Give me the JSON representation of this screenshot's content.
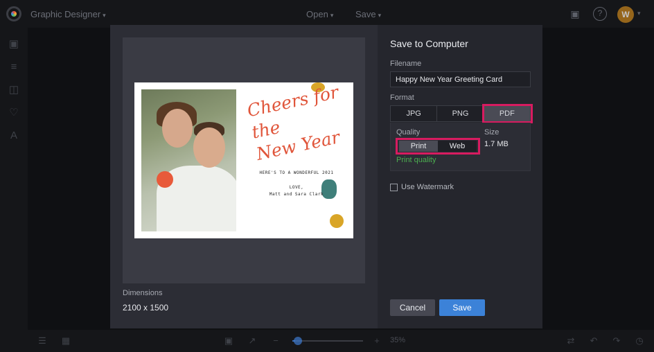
{
  "app": {
    "title": "Graphic Designer",
    "menu": {
      "open": "Open",
      "save": "Save"
    },
    "avatar_initial": "W",
    "icons": [
      "chat-icon",
      "help-icon",
      "chevron-down-icon"
    ]
  },
  "left_rail": {
    "icons": [
      "image-icon",
      "adjust-icon",
      "layout-icon",
      "heart-icon",
      "text-icon"
    ]
  },
  "bottom_bar": {
    "zoom_label": "35%",
    "zoom_level": 0.35,
    "icons": [
      "layers-icon",
      "template-icon",
      "fit-icon",
      "expand-icon",
      "zoom-out-icon",
      "zoom-in-icon",
      "repeat-icon",
      "undo-icon",
      "redo-icon",
      "history-icon"
    ]
  },
  "preview": {
    "card": {
      "script": "Cheers for the\nNew Year",
      "line1": "HERE'S TO A WONDERFUL 2021",
      "line2": "LOVE,",
      "line3": "Matt and Sara Clark"
    },
    "dimensions_label": "Dimensions",
    "dimensions_value": "2100 x 1500"
  },
  "save_panel": {
    "title": "Save to Computer",
    "filename_label": "Filename",
    "filename_value": "Happy New Year Greeting Card",
    "format_label": "Format",
    "formats": [
      "JPG",
      "PNG",
      "PDF"
    ],
    "selected_format": "PDF",
    "quality_label": "Quality",
    "quality_options": [
      "Print",
      "Web"
    ],
    "selected_quality": "Print",
    "quality_hint": "Print quality",
    "size_label": "Size",
    "size_value": "1.7 MB",
    "watermark_label": "Use Watermark",
    "watermark_checked": false,
    "cancel_label": "Cancel",
    "save_label": "Save"
  },
  "colors": {
    "accent": "#3c82d8",
    "highlight": "#d81b60",
    "success": "#4caf50"
  }
}
